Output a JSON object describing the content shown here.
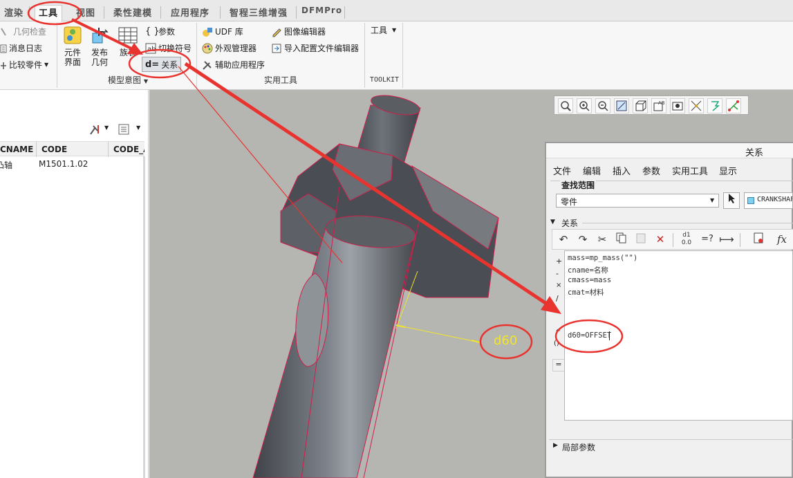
{
  "tabs": {
    "render": "渲染",
    "tools": "工具",
    "view": "视图",
    "flex": "柔性建模",
    "apps": "应用程序",
    "smart3d": "智程三维增强",
    "dfm": "DFMPro"
  },
  "ribbon": {
    "geom_check": "几何检查",
    "msg_log": "消息日志",
    "compare_parts": "比较零件",
    "element_ui_line1": "元件",
    "element_ui_line2": "界面",
    "publish_geom_line1": "发布",
    "publish_geom_line2": "几何",
    "family_table": "族表",
    "params": "参数",
    "switch_symbol": "切换符号",
    "relations": "关系",
    "relations_prefix": "d=",
    "udf_lib": "UDF 库",
    "appearance_mgr": "外观管理器",
    "aux_apps": "辅助应用程序",
    "image_editor": "图像编辑器",
    "import_cfg_editor": "导入配置文件编辑器",
    "tools_dd": "工具",
    "grp_model_intent": "模型意图",
    "grp_utilities": "实用工具",
    "grp_toolkit": "TOOLKIT"
  },
  "tree": {
    "columns": [
      "CNAME",
      "CODE",
      "CODE_A"
    ],
    "rows": [
      {
        "cname": "凸轴",
        "code": "M1501.1.02"
      }
    ]
  },
  "viewport": {
    "dim_label": "d60"
  },
  "dialog": {
    "title": "关系",
    "menu": [
      "文件",
      "编辑",
      "插入",
      "参数",
      "实用工具",
      "显示"
    ],
    "find_scope_label": "查找范围",
    "scope_value": "零件",
    "model_name": "CRANKSHAF",
    "relations_section": "关系",
    "relations_lines": [
      "mass=mp_mass(\"\")",
      "cname=名称",
      "cmass=mass",
      "cmat=材料",
      "",
      "",
      "d60=OFFSET"
    ],
    "local_params": "局部参数",
    "ops": [
      "+",
      "-",
      "×",
      "/",
      "^",
      "()",
      "="
    ]
  },
  "colors": {
    "accent_red": "#e8332f",
    "dim_yellow": "#f2e628",
    "body_gray": "#595d62"
  }
}
